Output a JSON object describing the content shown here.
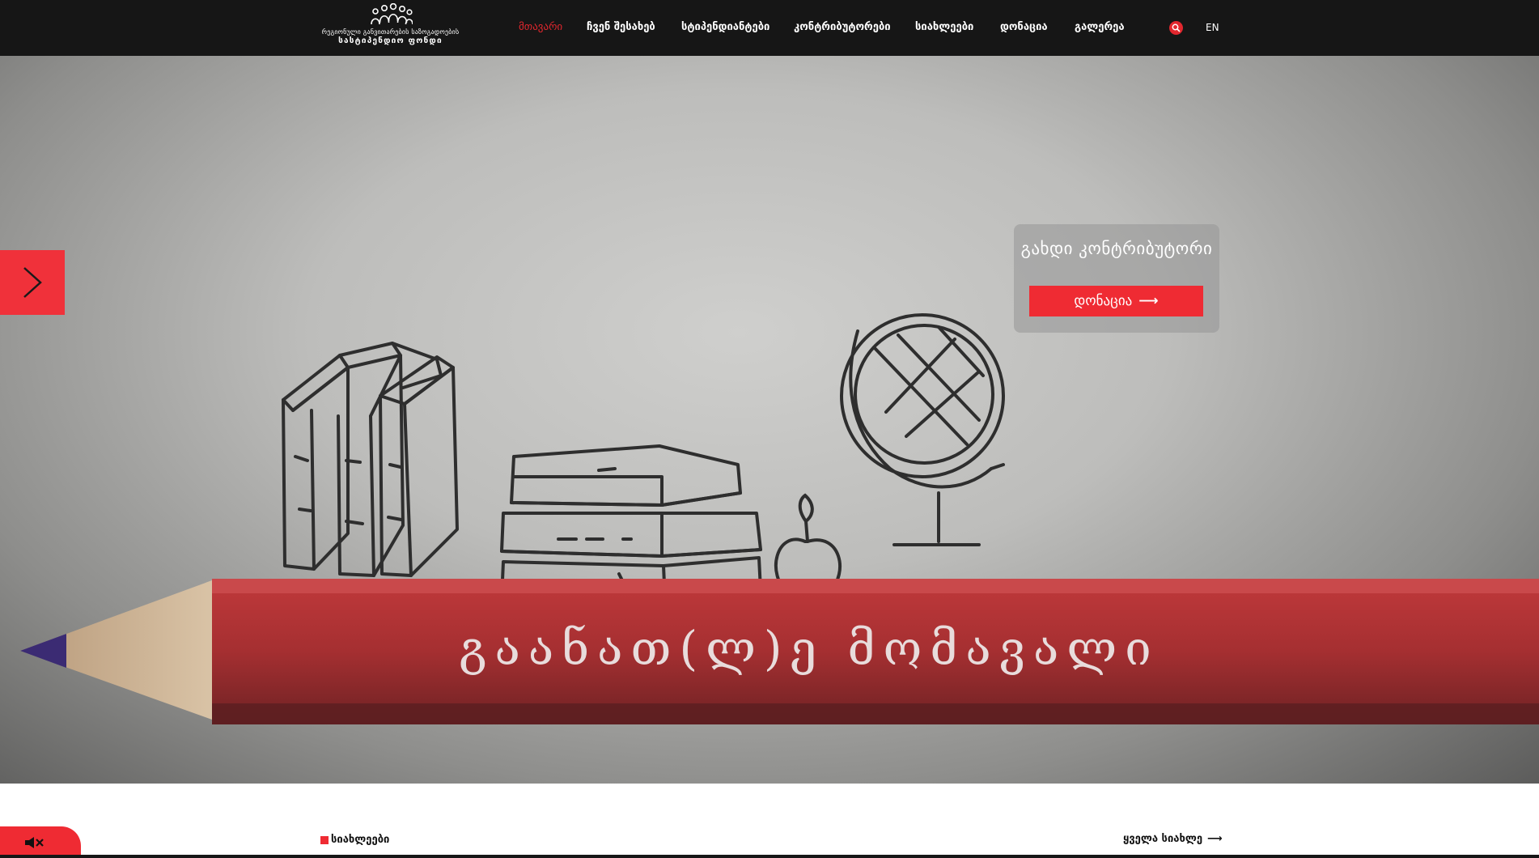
{
  "logo": {
    "line1": "რეგიონული განვითარების საზოგადოების",
    "line2": "სასტიპენდიო ფონდი"
  },
  "nav": [
    {
      "label": "მთავარი",
      "active": true
    },
    {
      "label": "ჩვენ შესახებ",
      "active": false
    },
    {
      "label": "სტიპენდიანტები",
      "active": false
    },
    {
      "label": "კონტრიბუტორები",
      "active": false
    },
    {
      "label": "სიახლეები",
      "active": false
    },
    {
      "label": "დონაცია",
      "active": false
    },
    {
      "label": "გალერეა",
      "active": false
    }
  ],
  "header": {
    "language": "EN",
    "search_icon": "search-icon"
  },
  "hero": {
    "pencil_text": "გაანათ(ლ)ე  მომავალი",
    "donate_card": {
      "title": "გახდი კონტრიბუტორი",
      "button": "დონაცია"
    },
    "next_icon": "chevron-right-icon"
  },
  "news": {
    "label": "სიახლეები",
    "all_link": "ყველა სიახლე"
  },
  "sound": {
    "icon": "speaker-muted-icon"
  },
  "colors": {
    "accent": "#ef2b33",
    "header_bg": "#161616"
  }
}
